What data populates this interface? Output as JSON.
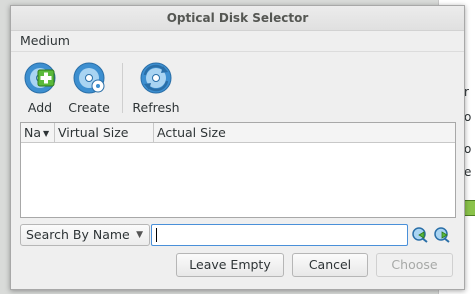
{
  "window": {
    "title": "Optical Disk Selector"
  },
  "menubar": {
    "medium": "Medium"
  },
  "toolbar": {
    "add": "Add",
    "create": "Create",
    "refresh": "Refresh"
  },
  "table": {
    "columns": [
      "Na",
      "Virtual Size",
      "Actual Size"
    ],
    "rows": []
  },
  "search": {
    "mode": "Search By Name",
    "value": ""
  },
  "buttons": {
    "leave_empty": "Leave Empty",
    "cancel": "Cancel",
    "choose": "Choose"
  },
  "background": {
    "glyphs": [
      "r",
      "o",
      "o",
      "e"
    ]
  },
  "colors": {
    "accent": "#4a90d9",
    "icon_blue": "#3d8fd0",
    "icon_green": "#5ab93b"
  }
}
